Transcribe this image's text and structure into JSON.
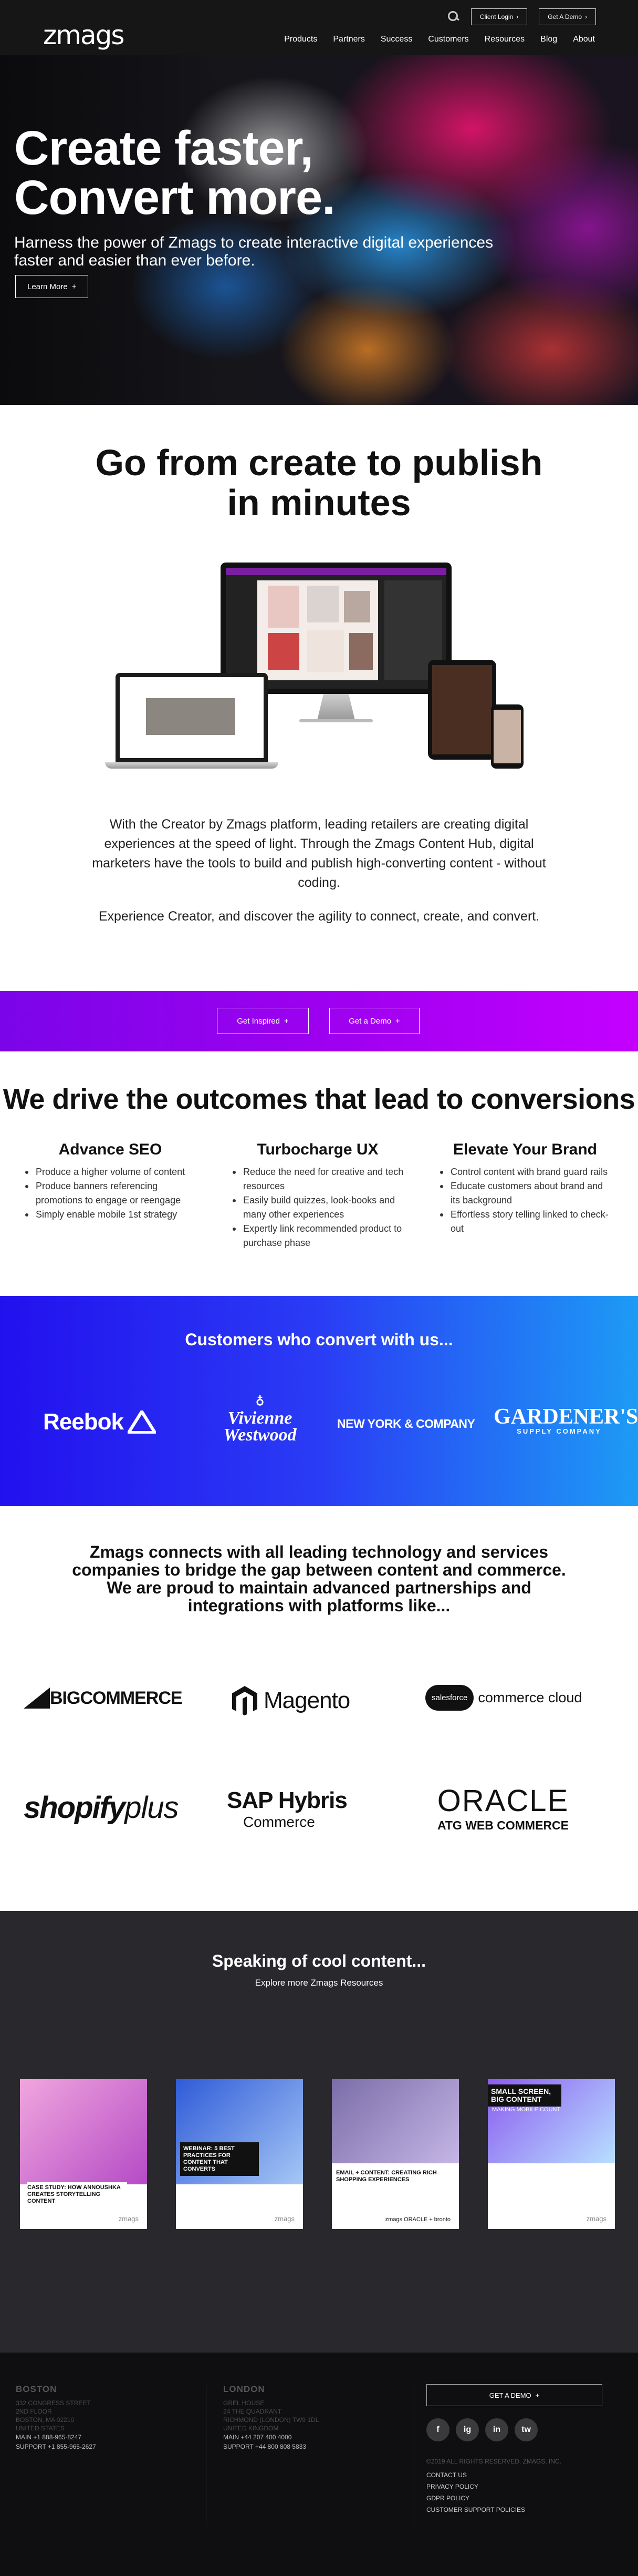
{
  "header": {
    "logo": "zmags",
    "client_login": "Client Login",
    "get_demo": "Get A Demo",
    "nav": [
      "Products",
      "Partners",
      "Success",
      "Customers",
      "Resources",
      "Blog",
      "About"
    ]
  },
  "hero": {
    "title_line1": "Create faster,",
    "title_line2": "Convert more.",
    "subtitle": "Harness the power of Zmags to create interactive digital experiences faster and easier than ever before.",
    "button": "Learn More"
  },
  "create": {
    "title_line1": "Go from create to publish",
    "title_line2": "in minutes",
    "paragraph1": "With the Creator by Zmags platform, leading retailers are creating digital experiences at the speed of light. Through the Zmags Content Hub, digital marketers have the tools to build and publish high-converting content - without coding.",
    "paragraph2": "Experience Creator, and discover the agility to connect, create, and convert."
  },
  "cta": {
    "inspired": "Get Inspired",
    "demo": "Get a Demo"
  },
  "outcomes": {
    "title": "We drive the outcomes that lead to conversions",
    "columns": [
      {
        "title": "Advance SEO",
        "items": [
          "Produce a higher volume of content",
          "Produce banners referencing promotions to engage or reengage",
          "Simply enable mobile 1st strategy"
        ]
      },
      {
        "title": "Turbocharge UX",
        "items": [
          "Reduce the need for creative and tech resources",
          "Easily build quizzes, look-books and many other experiences",
          "Expertly link recommended product to purchase phase"
        ]
      },
      {
        "title": "Elevate Your Brand",
        "items": [
          "Control content with brand guard rails",
          "Educate customers about brand and its background",
          "Effortless story telling linked to check-out"
        ]
      }
    ]
  },
  "customers": {
    "title": "Customers who convert with us...",
    "brands": [
      "Reebok",
      "Vivienne",
      "Westwood",
      "NEW YORK & COMPANY",
      "GARDENER'S",
      "SUPPLY COMPANY"
    ]
  },
  "partners": {
    "text": "Zmags connects with all leading technology and services companies to bridge the gap between content and commerce. We are proud to maintain advanced partnerships and integrations with platforms like...",
    "logos": {
      "bigcommerce": "BIGCOMMERCE",
      "magento": "Magento",
      "salesforce_badge": "salesforce",
      "salesforce_text": "commerce cloud",
      "shopify": "shopify",
      "shopify_plus": "plus",
      "sap": "SAP Hybris",
      "sap_sub": "Commerce",
      "oracle": "ORACLE",
      "oracle_sub": "ATG WEB COMMERCE"
    }
  },
  "speaking": {
    "title": "Speaking of cool content...",
    "subtitle": "Explore more Zmags Resources",
    "cards": [
      {
        "caption": "CASE STUDY: HOW ANNOUSHKA CREATES STORYTELLING CONTENT",
        "brand": "zmags"
      },
      {
        "caption": "WEBINAR: 5 BEST PRACTICES FOR CONTENT THAT CONVERTS",
        "brand": "zmags"
      },
      {
        "caption": "EMAIL + CONTENT: CREATING RICH SHOPPING EXPERIENCES",
        "brand": "zmags ORACLE + bronto"
      },
      {
        "caption": "SMALL SCREEN, BIG CONTENT",
        "sub": "MAKING MOBILE COUNT",
        "brand": "zmags"
      }
    ]
  },
  "footer": {
    "boston": {
      "title": "BOSTON",
      "address": [
        "332 CONGRESS STREET",
        "2ND FLOOR",
        "BOSTON, MA 02210",
        "UNITED STATES"
      ],
      "main": "MAIN +1 888-965-8247",
      "support": "SUPPORT +1 855-965-2627"
    },
    "london": {
      "title": "LONDON",
      "address": [
        "GREL HOUSE",
        "24 THE QUADRANT",
        "RICHMOND (LONDON) TW9 1DL",
        "UNITED KINGDOM"
      ],
      "main": "MAIN +44 207 400 4000",
      "support": "SUPPORT +44 800 808 5833"
    },
    "demo": "GET A DEMO",
    "social": [
      "f",
      "ig",
      "in",
      "tw"
    ],
    "copyright": "©2019 ALL RIGHTS RESERVED. ZMAGS, INC.",
    "links": [
      "CONTACT US",
      "PRIVACY POLICY",
      "GDPR POLICY",
      "CUSTOMER SUPPORT POLICIES"
    ]
  }
}
